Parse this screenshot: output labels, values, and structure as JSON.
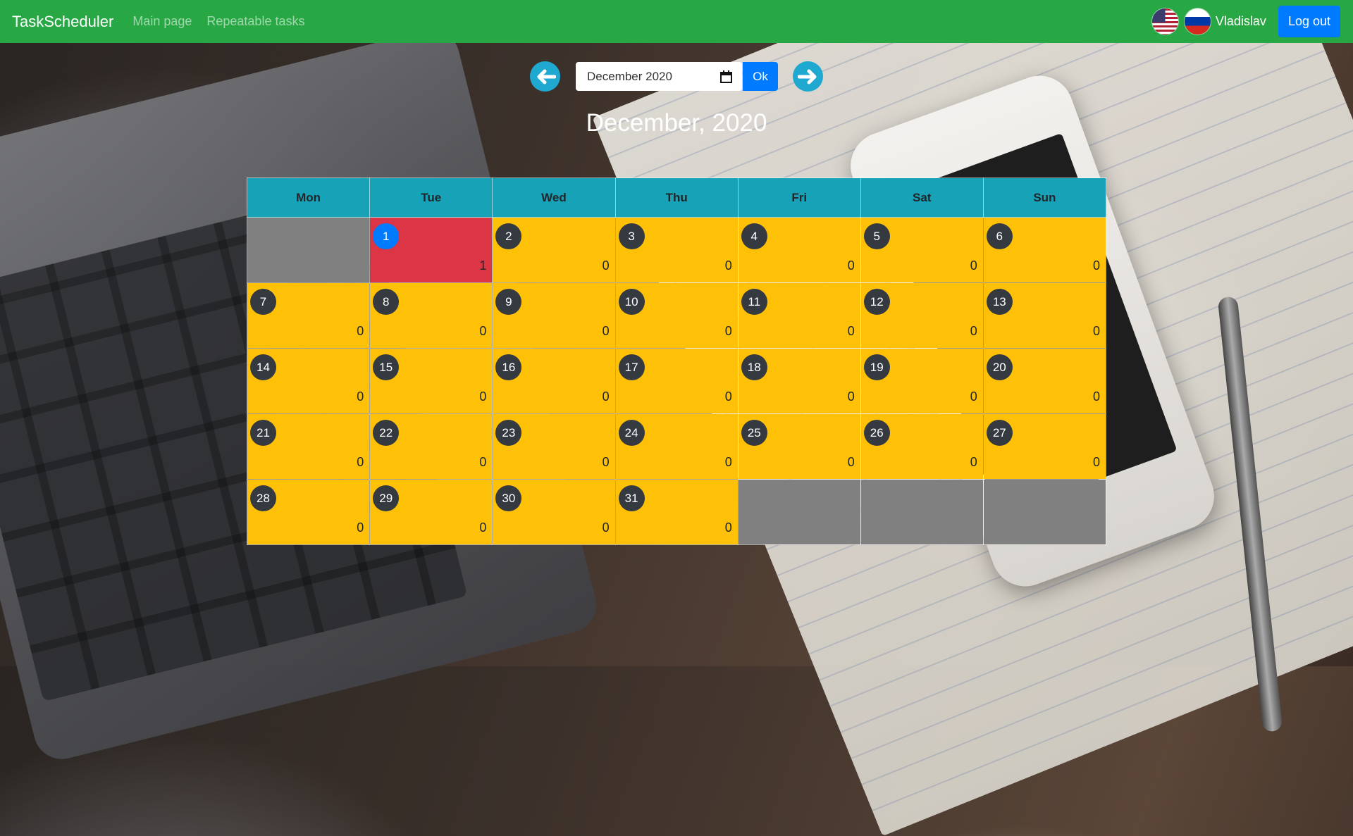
{
  "navbar": {
    "brand": "TaskScheduler",
    "links": [
      "Main page",
      "Repeatable tasks"
    ],
    "username": "Vladislav",
    "logout_label": "Log out",
    "bg_color": "#28a745"
  },
  "picker": {
    "month_value": "December 2020",
    "ok_label": "Ok",
    "prev_icon": "arrow-left-icon",
    "next_icon": "arrow-right-icon",
    "calendar_icon": "calendar-icon"
  },
  "month_title": "December, 2020",
  "calendar": {
    "weekdays": [
      "Mon",
      "Tue",
      "Wed",
      "Thu",
      "Fri",
      "Sat",
      "Sun"
    ],
    "colors": {
      "header": "#17a2b8",
      "day": "#ffc107",
      "today": "#dc3545",
      "empty": "#808080",
      "day_circle": "#343a40",
      "today_circle": "#007bff"
    },
    "weeks": [
      [
        null,
        {
          "day": "1",
          "count": "1",
          "today": true
        },
        {
          "day": "2",
          "count": "0"
        },
        {
          "day": "3",
          "count": "0"
        },
        {
          "day": "4",
          "count": "0"
        },
        {
          "day": "5",
          "count": "0"
        },
        {
          "day": "6",
          "count": "0"
        }
      ],
      [
        {
          "day": "7",
          "count": "0"
        },
        {
          "day": "8",
          "count": "0"
        },
        {
          "day": "9",
          "count": "0"
        },
        {
          "day": "10",
          "count": "0"
        },
        {
          "day": "11",
          "count": "0"
        },
        {
          "day": "12",
          "count": "0"
        },
        {
          "day": "13",
          "count": "0"
        }
      ],
      [
        {
          "day": "14",
          "count": "0"
        },
        {
          "day": "15",
          "count": "0"
        },
        {
          "day": "16",
          "count": "0"
        },
        {
          "day": "17",
          "count": "0"
        },
        {
          "day": "18",
          "count": "0"
        },
        {
          "day": "19",
          "count": "0"
        },
        {
          "day": "20",
          "count": "0"
        }
      ],
      [
        {
          "day": "21",
          "count": "0"
        },
        {
          "day": "22",
          "count": "0"
        },
        {
          "day": "23",
          "count": "0"
        },
        {
          "day": "24",
          "count": "0"
        },
        {
          "day": "25",
          "count": "0"
        },
        {
          "day": "26",
          "count": "0"
        },
        {
          "day": "27",
          "count": "0"
        }
      ],
      [
        {
          "day": "28",
          "count": "0"
        },
        {
          "day": "29",
          "count": "0"
        },
        {
          "day": "30",
          "count": "0"
        },
        {
          "day": "31",
          "count": "0"
        },
        null,
        null,
        null
      ]
    ]
  }
}
